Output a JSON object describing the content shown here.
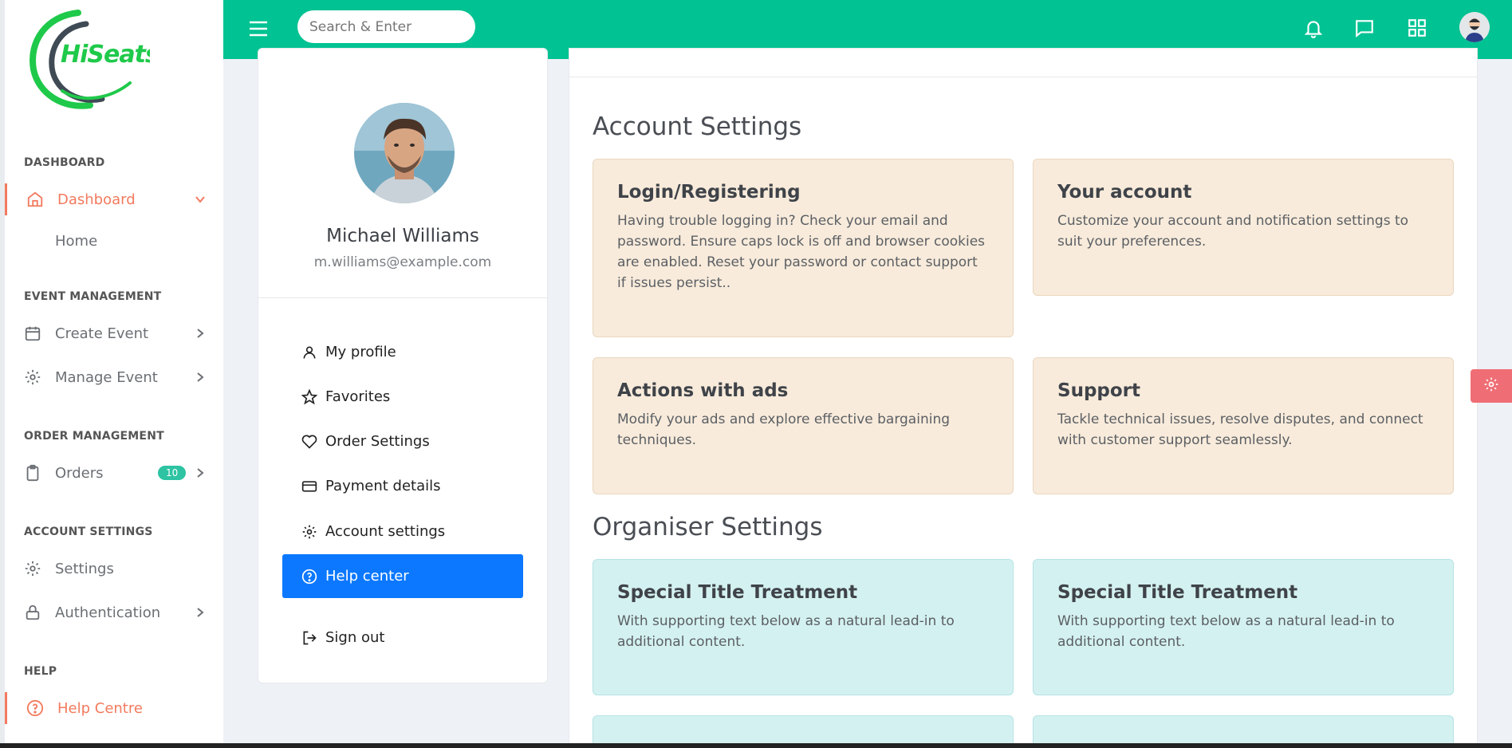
{
  "brand": {
    "logo_text": "HiSeats"
  },
  "sidebar": {
    "sections": [
      {
        "label": "DASHBOARD"
      },
      {
        "label": "EVENT MANAGEMENT"
      },
      {
        "label": "ORDER MANAGEMENT"
      },
      {
        "label": "ACCOUNT SETTINGS"
      },
      {
        "label": "HELP"
      }
    ],
    "items": {
      "dashboard": "Dashboard",
      "home": "Home",
      "create_event": "Create Event",
      "manage_event": "Manage Event",
      "orders": "Orders",
      "orders_badge": "10",
      "settings": "Settings",
      "authentication": "Authentication",
      "help_centre": "Help Centre"
    }
  },
  "topbar": {
    "search_placeholder": "Search & Enter",
    "icons": [
      "menu-icon",
      "bell-icon",
      "chat-icon",
      "apps-grid-icon",
      "user-avatar"
    ]
  },
  "profile": {
    "name": "Michael Williams",
    "email": "m.williams@example.com",
    "menu": [
      {
        "label": "My profile",
        "icon": "user-icon"
      },
      {
        "label": "Favorites",
        "icon": "star-icon"
      },
      {
        "label": "Order Settings",
        "icon": "heart-icon"
      },
      {
        "label": "Payment details",
        "icon": "credit-card-icon"
      },
      {
        "label": "Account settings",
        "icon": "gear-icon"
      },
      {
        "label": "Help center",
        "icon": "help-circle-icon",
        "active": true
      },
      {
        "label": "Sign out",
        "icon": "sign-out-icon"
      }
    ]
  },
  "content": {
    "account_settings_title": "Account Settings",
    "organiser_settings_title": "Organiser Settings",
    "account_tiles": [
      {
        "title": "Login/Registering",
        "text": "Having trouble logging in? Check your email and password. Ensure caps lock is off and browser cookies are enabled. Reset your password or contact support if issues persist.."
      },
      {
        "title": "Your account",
        "text": "Customize your account and notification settings to suit your preferences."
      },
      {
        "title": "Actions with ads",
        "text": "Modify your ads and explore effective bargaining techniques."
      },
      {
        "title": "Support",
        "text": "Tackle technical issues, resolve disputes, and connect with customer support seamlessly."
      }
    ],
    "organiser_tiles": [
      {
        "title": "Special Title Treatment",
        "text": "With supporting text below as a natural lead-in to additional content."
      },
      {
        "title": "Special Title Treatment",
        "text": "With supporting text below as a natural lead-in to additional content."
      }
    ]
  },
  "colors": {
    "primary": "#00c292",
    "accent_orange": "#f27a5e",
    "active_blue": "#0b78ff",
    "tile_orange": "#f8ebdb",
    "tile_cyan": "#d4f1f1",
    "settings_fab": "#ef6e75"
  }
}
